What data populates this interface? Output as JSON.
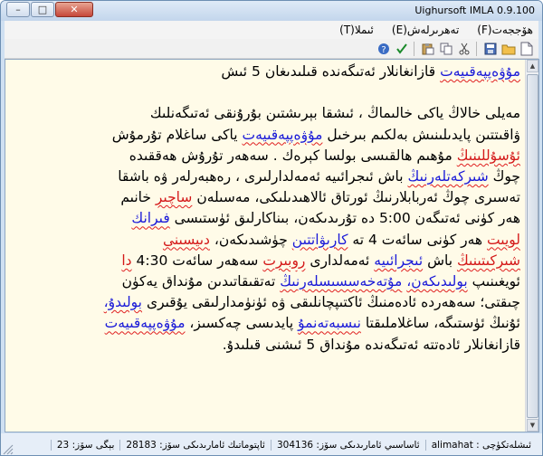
{
  "window": {
    "title": "Uighursoft IMLA 0.9.100",
    "close_glyph": "✕",
    "maximize_glyph": "□",
    "minimize_glyph": "–"
  },
  "menu": {
    "items": [
      {
        "label": "ھۆججەت(F)"
      },
      {
        "label": "تەھرىرلەش(E)"
      },
      {
        "label": "ئىملا(T)"
      }
    ]
  },
  "toolbar": {
    "buttons": [
      {
        "icon": "new-document-icon"
      },
      {
        "icon": "open-folder-icon"
      },
      {
        "icon": "save-icon"
      },
      {
        "icon": "cut-icon"
      },
      {
        "icon": "copy-icon"
      },
      {
        "icon": "paste-icon"
      },
      {
        "icon": "spellcheck-icon"
      },
      {
        "icon": "help-icon"
      }
    ]
  },
  "document": {
    "line1": {
      "a": "مۇۋەپپەقىيەت",
      "b": " قازانغانلار ئەتىگەندە قىلىدىغان 5 ئىش"
    },
    "line2": "",
    "line3": "مەيلى خالاڭ ياكى خالىماڭ ، ئىشقا بېرىشتىن بۇرۇنقى ئەتىگەنلىك",
    "line4": {
      "a": "ۋاقىتتىن پايدىلىنىش بەلكىم بىرخىل ",
      "b": "مۇۋەپپەقىيەت",
      "c": " ياكى ساغلام تۇرمۇش"
    },
    "line5": {
      "a": "ئۇسۇللىنىڭ",
      "b": " مۇھىم ھالقىسى بولسا كېرەك . سەھەر تۇرۇش ھەققىدە"
    },
    "line6": {
      "a": "چوڭ ",
      "b": "شىركەتلەرنىڭ",
      "c": " باش ئىجرائىيە ئەمەلدارلىرى ، رەھبەرلەر ۋە باشقا"
    },
    "line7": {
      "a": "تەسىرى چوڭ ئەربابلارنىڭ ئورتاق ئالاھىدىلىكى، مەسىلەن ",
      "b": "ساچىر",
      "c": " خانىم"
    },
    "line8": {
      "a": "ھەر كۈنى ئەتىگەن 5:00 دە تۇرىدىكەن، بىناكارلىق ئۈستىسى ",
      "b": "فىرانك"
    },
    "line9": {
      "a": "لويىت",
      "b": " ھەر كۈنى سائەت 4 تە ",
      "c": "كارىۋاتتىن",
      "d": " چۈشىدىكەن، ",
      "e": "دىيسىنى"
    },
    "line10": {
      "a": "شىركىتىنىڭ",
      "b": " باش ",
      "c": "ئىجرائىيە",
      "d": " ئەمەلدارى ",
      "e": "روبىرت",
      "f": " سەھەر سائەت 4:30 ",
      "g": "دا"
    },
    "line11": {
      "a": "ئويغىنىپ ",
      "b": "بولىدىكەن،",
      "c": " ",
      "d": "مۇتەخەسسىسلەرنىڭ",
      "e": " تەتقىقاتىدىن مۇنداق يەكۈن"
    },
    "line12": {
      "a": "چىقتى؛ سەھەردە ئادەمنىڭ ئاكتىپچانلىقى ۋە ئۈنۈمدارلىقى يۇقىرى ",
      "b": "بولىدۇ،"
    },
    "line13": {
      "a": "ئۇنىڭ ئۈستىگە، ساغلاملىقتا ",
      "b": "نىسبەتەنمۇ",
      "c": " پايدىسى چەكسىز، ",
      "d": "مۇۋەپپەقىيەت"
    },
    "line14": "قازانغانلار ئادەتتە ئەتىگەندە مۇنداق 5 ئىشنى قىلىدۇ."
  },
  "status": {
    "user": "ئىشلەتكۈچى : alimahat",
    "total_words": "ئاساسىي ئامارىدىكى سۆز: 304136",
    "known_words": "ئاپتوماتىك ئامارىدىكى سۆز: 28183",
    "current_words": "بېگى سۆز: 23"
  },
  "colors": {
    "editor_bg": "#fffbe8",
    "blue_highlight": "#1a1ad8",
    "red_highlight": "#d41a1a",
    "squiggle": "#e02020"
  }
}
